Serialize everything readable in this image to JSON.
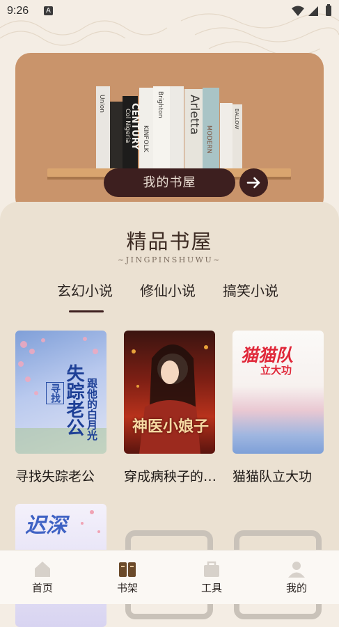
{
  "status_bar": {
    "time": "9:26",
    "notification_badge": "A"
  },
  "hero": {
    "button_label": "我的书屋",
    "arrow_icon": "arrow-right-icon"
  },
  "section": {
    "title": "精品书屋",
    "subtitle": "~JINGPINSHUWU~"
  },
  "tabs": [
    {
      "label": "玄幻小说",
      "active": true
    },
    {
      "label": "修仙小说",
      "active": false
    },
    {
      "label": "搞笑小说",
      "active": false
    }
  ],
  "books": [
    {
      "title": "寻找失踪老公",
      "cover_text": "寻找 失踪老公 跟他的白月光"
    },
    {
      "title": "穿成病秧子的神医小娘子",
      "cover_text": "神医小娘子"
    },
    {
      "title": "猫猫队立大功",
      "cover_text": "猫猫队 立大功"
    },
    {
      "title": "",
      "cover_text": "迟深"
    },
    {
      "title": "",
      "cover_text": ""
    },
    {
      "title": "",
      "cover_text": ""
    }
  ],
  "nav": [
    {
      "label": "首页",
      "icon": "home-icon"
    },
    {
      "label": "书架",
      "icon": "bookshelf-icon"
    },
    {
      "label": "工具",
      "icon": "toolbox-icon"
    },
    {
      "label": "我的",
      "icon": "profile-icon"
    }
  ],
  "colors": {
    "hero_bg": "#c9946b",
    "panel_bg": "#ebe1d2",
    "button_dark": "#3d1f1f"
  }
}
